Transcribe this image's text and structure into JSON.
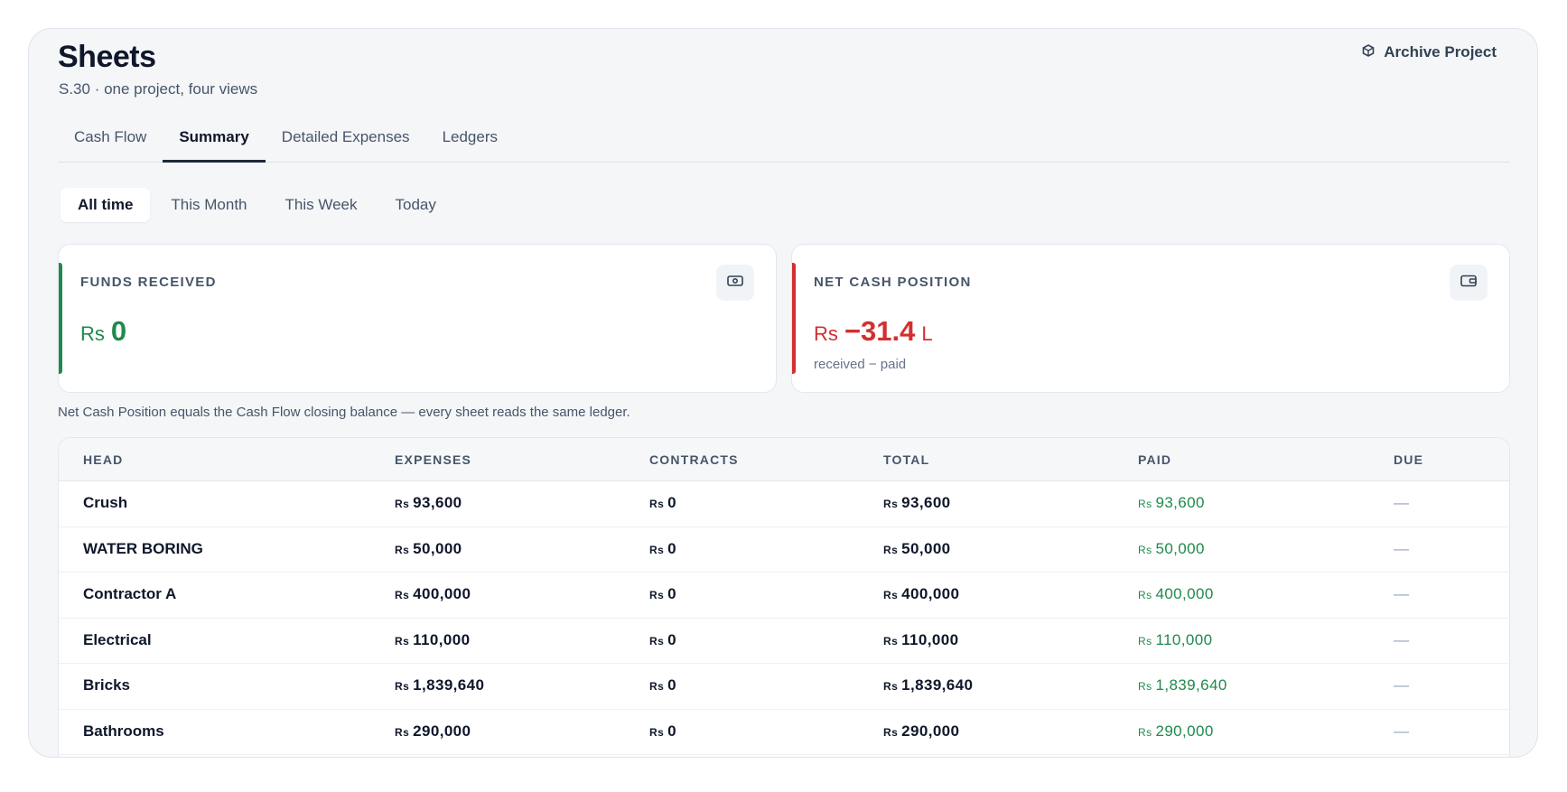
{
  "page": {
    "title": "Sheets",
    "subtitle": "S.30 · one project, four views",
    "archive_label": "Archive Project",
    "archive_icon": "archive-box-icon"
  },
  "tabs": [
    {
      "label": "Cash Flow",
      "active": false
    },
    {
      "label": "Summary",
      "active": true
    },
    {
      "label": "Detailed Expenses",
      "active": false
    },
    {
      "label": "Ledgers",
      "active": false
    }
  ],
  "periods": [
    {
      "label": "All time",
      "active": true
    },
    {
      "label": "This Month",
      "active": false
    },
    {
      "label": "This Week",
      "active": false
    },
    {
      "label": "Today",
      "active": false
    }
  ],
  "cards": {
    "funds": {
      "label": "FUNDS RECEIVED",
      "currency": "Rs",
      "value": "0",
      "icon": "banknote-icon",
      "accent": "#1f8a4c"
    },
    "net": {
      "label": "NET CASH POSITION",
      "currency": "Rs",
      "value": "−31.4",
      "unit": "L",
      "sub": "received − paid",
      "icon": "wallet-icon",
      "accent": "#d32f2f"
    }
  },
  "note": "Net Cash Position equals the Cash Flow closing balance — every sheet reads the same ledger.",
  "table": {
    "currency": "Rs",
    "columns": [
      "HEAD",
      "EXPENSES",
      "CONTRACTS",
      "TOTAL",
      "PAID",
      "DUE"
    ],
    "rows": [
      {
        "head": "Crush",
        "expenses": "93,600",
        "contracts": "0",
        "total": "93,600",
        "paid": "93,600",
        "due": "—"
      },
      {
        "head": "WATER BORING",
        "expenses": "50,000",
        "contracts": "0",
        "total": "50,000",
        "paid": "50,000",
        "due": "—"
      },
      {
        "head": "Contractor A",
        "expenses": "400,000",
        "contracts": "0",
        "total": "400,000",
        "paid": "400,000",
        "due": "—"
      },
      {
        "head": "Electrical",
        "expenses": "110,000",
        "contracts": "0",
        "total": "110,000",
        "paid": "110,000",
        "due": "—"
      },
      {
        "head": "Bricks",
        "expenses": "1,839,640",
        "contracts": "0",
        "total": "1,839,640",
        "paid": "1,839,640",
        "due": "—"
      },
      {
        "head": "Bathrooms",
        "expenses": "290,000",
        "contracts": "0",
        "total": "290,000",
        "paid": "290,000",
        "due": "—"
      }
    ]
  }
}
